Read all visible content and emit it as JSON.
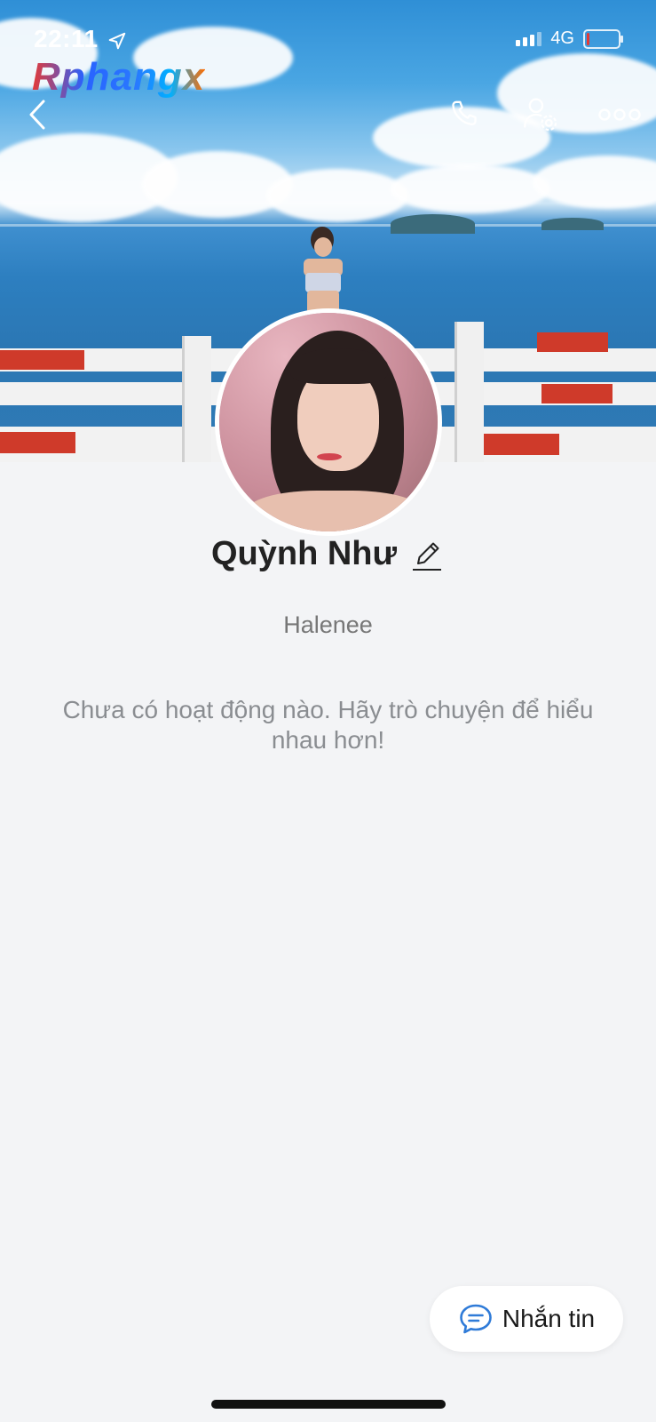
{
  "status_bar": {
    "time": "22:11",
    "network": "4G",
    "battery_level": 0.1
  },
  "watermark": {
    "text": "Rphangx"
  },
  "header": {
    "back_icon": "chevron-left-icon",
    "call_icon": "phone-icon",
    "settings_icon": "user-settings-icon",
    "more_icon": "more-horizontal-icon"
  },
  "profile": {
    "name": "Quỳnh Như",
    "username": "Halenee",
    "edit_icon": "pencil-icon",
    "empty_activity": "Chưa có hoạt động nào. Hãy trò chuyện để hiểu nhau hơn!"
  },
  "actions": {
    "message_label": "Nhắn tin",
    "message_icon": "chat-bubble-icon"
  },
  "colors": {
    "accent": "#2f7bd8",
    "background": "#f3f4f6",
    "battery_low": "#e53935"
  }
}
